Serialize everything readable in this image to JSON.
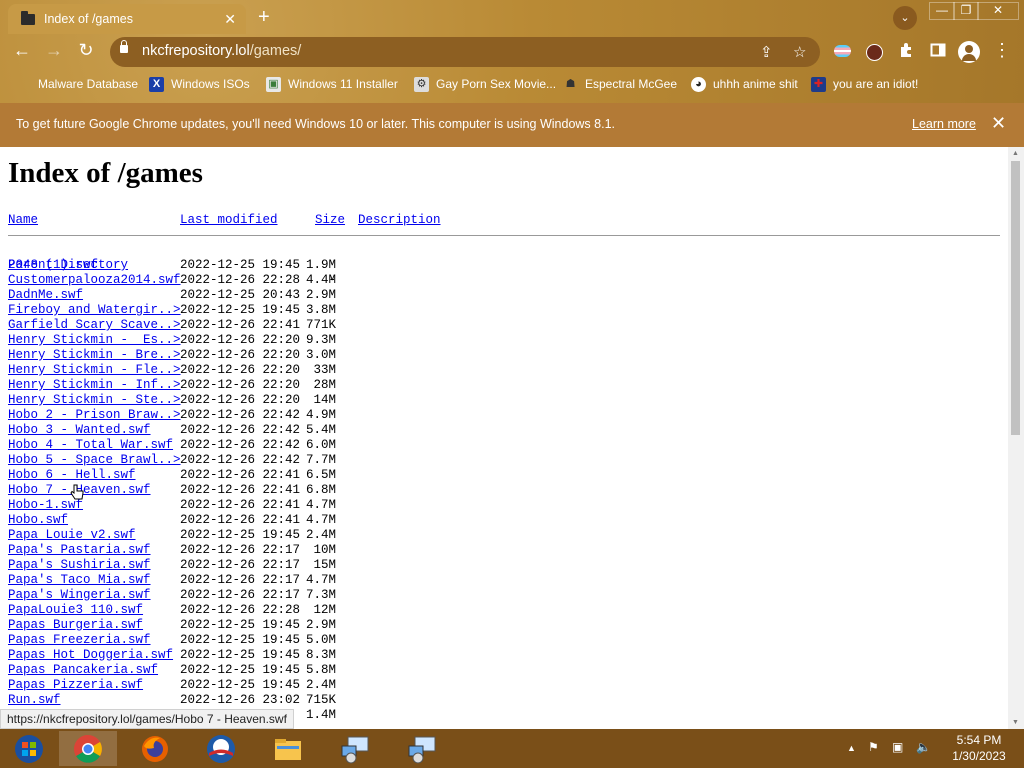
{
  "tab": {
    "title": "Index of /games",
    "close": "✕",
    "new_tab": "+",
    "tab_list": "⌄"
  },
  "window_controls": {
    "minimize": "—",
    "maximize": "❐",
    "close": "✕"
  },
  "toolbar": {
    "back": "←",
    "forward": "→",
    "reload": "↻",
    "menu": "⋮"
  },
  "omnibox": {
    "domain": "nkcfrepository.lol",
    "path": "/games/",
    "share_icon": "⇪",
    "star_icon": "☆"
  },
  "bookmarks": [
    {
      "label": "Malware Database",
      "icon": ""
    },
    {
      "label": "Windows ISOs",
      "icon": "X"
    },
    {
      "label": "Windows 11 Installer",
      "icon": "▣"
    },
    {
      "label": "Gay Porn Sex Movie...",
      "icon": "⚙"
    },
    {
      "label": "Espectral McGee",
      "icon": "☗"
    },
    {
      "label": "uhhh anime shit",
      "icon": "◕"
    },
    {
      "label": "you are an idiot!",
      "icon": "✚"
    }
  ],
  "infobar": {
    "message": "To get future Google Chrome updates, you'll need Windows 10 or later. This computer is using Windows 8.1.",
    "learn_more": "Learn more",
    "close": "✕"
  },
  "page": {
    "heading": "Index of /games",
    "columns": {
      "name": "Name",
      "last_modified": "Last modified",
      "size": "Size",
      "description": "Description"
    },
    "parent": {
      "name": "Parent Directory",
      "size": "-"
    },
    "files": [
      {
        "name": "2048 (1).swf",
        "date": "2022-12-25 19:45",
        "size": "1.9M"
      },
      {
        "name": "Customerpalooza2014.swf",
        "date": "2022-12-26 22:28",
        "size": "4.4M"
      },
      {
        "name": "DadnMe.swf",
        "date": "2022-12-25 20:43",
        "size": "2.9M"
      },
      {
        "name": "Fireboy and Watergir..>",
        "date": "2022-12-25 19:45",
        "size": "3.8M"
      },
      {
        "name": "Garfield Scary Scave..>",
        "date": "2022-12-26 22:41",
        "size": "771K"
      },
      {
        "name": "Henry Stickmin -  Es..>",
        "date": "2022-12-26 22:20",
        "size": "9.3M"
      },
      {
        "name": "Henry Stickmin - Bre..>",
        "date": "2022-12-26 22:20",
        "size": "3.0M"
      },
      {
        "name": "Henry Stickmin - Fle..>",
        "date": "2022-12-26 22:20",
        "size": "33M"
      },
      {
        "name": "Henry Stickmin - Inf..>",
        "date": "2022-12-26 22:20",
        "size": "28M"
      },
      {
        "name": "Henry Stickmin - Ste..>",
        "date": "2022-12-26 22:20",
        "size": "14M"
      },
      {
        "name": "Hobo 2 - Prison Braw..>",
        "date": "2022-12-26 22:42",
        "size": "4.9M"
      },
      {
        "name": "Hobo 3 - Wanted.swf",
        "date": "2022-12-26 22:42",
        "size": "5.4M"
      },
      {
        "name": "Hobo 4 - Total War.swf",
        "date": "2022-12-26 22:42",
        "size": "6.0M"
      },
      {
        "name": "Hobo 5 - Space Brawl..>",
        "date": "2022-12-26 22:42",
        "size": "7.7M"
      },
      {
        "name": "Hobo 6 - Hell.swf",
        "date": "2022-12-26 22:41",
        "size": "6.5M"
      },
      {
        "name": "Hobo 7 - Heaven.swf",
        "date": "2022-12-26 22:41",
        "size": "6.8M"
      },
      {
        "name": "Hobo-1.swf",
        "date": "2022-12-26 22:41",
        "size": "4.7M"
      },
      {
        "name": "Hobo.swf",
        "date": "2022-12-26 22:41",
        "size": "4.7M"
      },
      {
        "name": "Papa Louie v2.swf",
        "date": "2022-12-25 19:45",
        "size": "2.4M"
      },
      {
        "name": "Papa's Pastaria.swf",
        "date": "2022-12-26 22:17",
        "size": "10M"
      },
      {
        "name": "Papa's Sushiria.swf",
        "date": "2022-12-26 22:17",
        "size": "15M"
      },
      {
        "name": "Papa's Taco Mia.swf",
        "date": "2022-12-26 22:17",
        "size": "4.7M"
      },
      {
        "name": "Papa's Wingeria.swf",
        "date": "2022-12-26 22:17",
        "size": "7.3M"
      },
      {
        "name": "PapaLouie3_110.swf",
        "date": "2022-12-26 22:28",
        "size": "12M"
      },
      {
        "name": "Papas Burgeria.swf",
        "date": "2022-12-25 19:45",
        "size": "2.9M"
      },
      {
        "name": "Papas Freezeria.swf",
        "date": "2022-12-25 19:45",
        "size": "5.0M"
      },
      {
        "name": "Papas Hot Doggeria.swf",
        "date": "2022-12-25 19:45",
        "size": "8.3M"
      },
      {
        "name": "Papas Pancakeria.swf",
        "date": "2022-12-25 19:45",
        "size": "5.8M"
      },
      {
        "name": "Papas Pizzeria.swf",
        "date": "2022-12-25 19:45",
        "size": "2.4M"
      },
      {
        "name": "Run.swf",
        "date": "2022-12-26 23:02",
        "size": "715K"
      },
      {
        "name": "",
        "date": "",
        "size": "1.4M"
      }
    ]
  },
  "status_url": "https://nkcfrepository.lol/games/Hobo 7 - Heaven.swf",
  "taskbar": {
    "apps": [
      "start",
      "chrome",
      "firefox",
      "obama",
      "file-explorer",
      "remote-desktop-1",
      "remote-desktop-2"
    ],
    "tray": {
      "chevron": "▲",
      "flag": "⚑",
      "network": "▣",
      "volume": "🔈"
    },
    "time": "5:54 PM",
    "date": "1/30/2023"
  },
  "colors": {
    "frame": "#b98a35",
    "infobar": "#b37a36",
    "link": "#0000ee",
    "taskbar": "#7a4f18"
  }
}
